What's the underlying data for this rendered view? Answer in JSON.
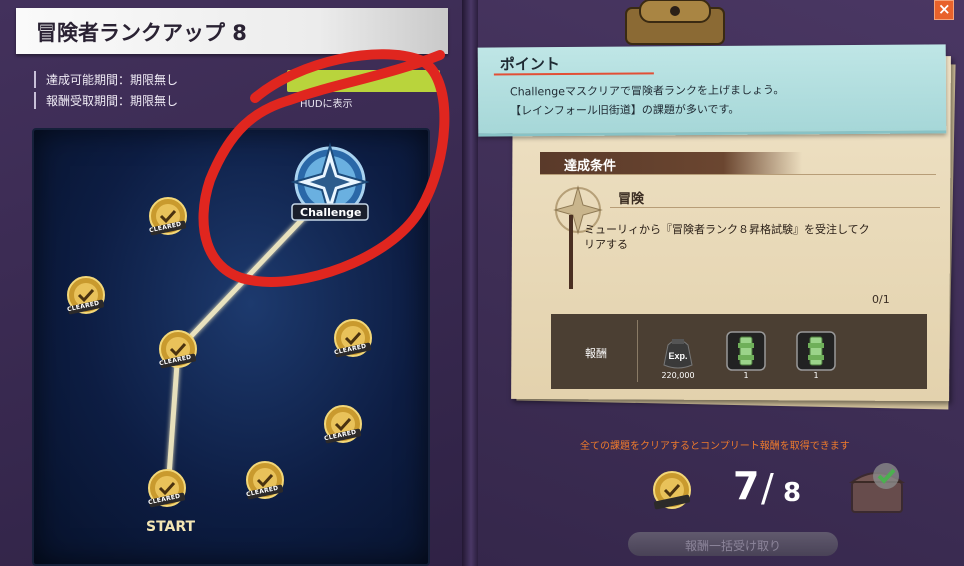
{
  "title": "冒険者ランクアップ 8",
  "period": {
    "achievable": "達成可能期間：期限無し",
    "reward_claim": "報酬受取期間：期限無し"
  },
  "hud_label": "HUDに表示",
  "map": {
    "nodes": [
      {
        "id": "start",
        "label": "CLEARED",
        "status": "cleared"
      },
      {
        "id": "n2",
        "label": "CLEARED",
        "status": "cleared"
      },
      {
        "id": "n3",
        "label": "CLEARED",
        "status": "cleared"
      },
      {
        "id": "n4",
        "label": "CLEARED",
        "status": "cleared"
      },
      {
        "id": "n5",
        "label": "CLEARED",
        "status": "cleared"
      },
      {
        "id": "n6",
        "label": "CLEARED",
        "status": "cleared"
      },
      {
        "id": "n7",
        "label": "CLEARED",
        "status": "cleared"
      }
    ],
    "challenge_label": "Challenge",
    "start_label": "START"
  },
  "point": {
    "title": "ポイント",
    "line1": "Challengeマスクリアで冒険者ランクを上げましょう。",
    "line2": "【レインフォール旧街道】の課題が多いです。"
  },
  "condition": {
    "header": "達成条件",
    "category": "冒険",
    "line1": "ミューリィから『冒険者ランク８昇格試験』を受注してク",
    "line2": "リアする",
    "progress": "0/1"
  },
  "reward": {
    "label": "報酬",
    "items": [
      {
        "icon": "exp-bag-icon",
        "badge": "Exp.",
        "qty": "220,000"
      },
      {
        "icon": "green-scroll-icon",
        "qty": "1"
      },
      {
        "icon": "green-scroll-icon",
        "qty": "1"
      }
    ]
  },
  "complete_text": "全ての課題をクリアするとコンプリート報酬を取得できます",
  "count": {
    "cleared": "7",
    "separator": "/",
    "total": "8"
  },
  "claim_button": "報酬一括受け取り",
  "close": "×",
  "colors": {
    "accent": "#e24f36",
    "hud_button": "#b9d43c",
    "notice": "#ee7a2c",
    "annotation": "#e0261f"
  }
}
